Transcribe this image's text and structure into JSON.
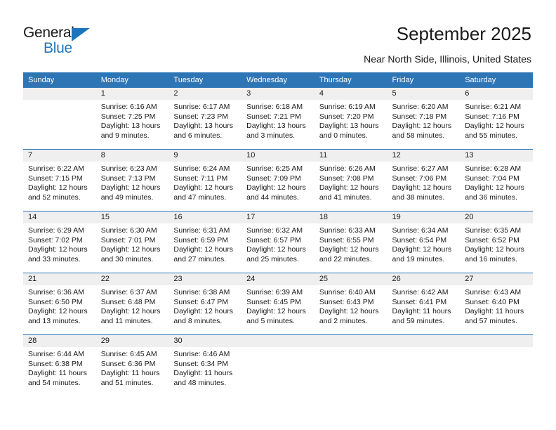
{
  "brand": {
    "name_top": "General",
    "name_bottom": "Blue",
    "accent_color": "#1c75bc"
  },
  "header": {
    "title": "September 2025",
    "subtitle": "Near North Side, Illinois, United States",
    "header_bg": "#2e75b6",
    "daynum_bg": "#efefef"
  },
  "weekdays": [
    "Sunday",
    "Monday",
    "Tuesday",
    "Wednesday",
    "Thursday",
    "Friday",
    "Saturday"
  ],
  "labels": {
    "sunrise": "Sunrise:",
    "sunset": "Sunset:",
    "daylight": "Daylight:"
  },
  "weeks": [
    [
      {
        "day": "",
        "empty": true
      },
      {
        "day": "1",
        "sunrise": "Sunrise: 6:16 AM",
        "sunset": "Sunset: 7:25 PM",
        "daylight1": "Daylight: 13 hours",
        "daylight2": "and 9 minutes."
      },
      {
        "day": "2",
        "sunrise": "Sunrise: 6:17 AM",
        "sunset": "Sunset: 7:23 PM",
        "daylight1": "Daylight: 13 hours",
        "daylight2": "and 6 minutes."
      },
      {
        "day": "3",
        "sunrise": "Sunrise: 6:18 AM",
        "sunset": "Sunset: 7:21 PM",
        "daylight1": "Daylight: 13 hours",
        "daylight2": "and 3 minutes."
      },
      {
        "day": "4",
        "sunrise": "Sunrise: 6:19 AM",
        "sunset": "Sunset: 7:20 PM",
        "daylight1": "Daylight: 13 hours",
        "daylight2": "and 0 minutes."
      },
      {
        "day": "5",
        "sunrise": "Sunrise: 6:20 AM",
        "sunset": "Sunset: 7:18 PM",
        "daylight1": "Daylight: 12 hours",
        "daylight2": "and 58 minutes."
      },
      {
        "day": "6",
        "sunrise": "Sunrise: 6:21 AM",
        "sunset": "Sunset: 7:16 PM",
        "daylight1": "Daylight: 12 hours",
        "daylight2": "and 55 minutes."
      }
    ],
    [
      {
        "day": "7",
        "sunrise": "Sunrise: 6:22 AM",
        "sunset": "Sunset: 7:15 PM",
        "daylight1": "Daylight: 12 hours",
        "daylight2": "and 52 minutes."
      },
      {
        "day": "8",
        "sunrise": "Sunrise: 6:23 AM",
        "sunset": "Sunset: 7:13 PM",
        "daylight1": "Daylight: 12 hours",
        "daylight2": "and 49 minutes."
      },
      {
        "day": "9",
        "sunrise": "Sunrise: 6:24 AM",
        "sunset": "Sunset: 7:11 PM",
        "daylight1": "Daylight: 12 hours",
        "daylight2": "and 47 minutes."
      },
      {
        "day": "10",
        "sunrise": "Sunrise: 6:25 AM",
        "sunset": "Sunset: 7:09 PM",
        "daylight1": "Daylight: 12 hours",
        "daylight2": "and 44 minutes."
      },
      {
        "day": "11",
        "sunrise": "Sunrise: 6:26 AM",
        "sunset": "Sunset: 7:08 PM",
        "daylight1": "Daylight: 12 hours",
        "daylight2": "and 41 minutes."
      },
      {
        "day": "12",
        "sunrise": "Sunrise: 6:27 AM",
        "sunset": "Sunset: 7:06 PM",
        "daylight1": "Daylight: 12 hours",
        "daylight2": "and 38 minutes."
      },
      {
        "day": "13",
        "sunrise": "Sunrise: 6:28 AM",
        "sunset": "Sunset: 7:04 PM",
        "daylight1": "Daylight: 12 hours",
        "daylight2": "and 36 minutes."
      }
    ],
    [
      {
        "day": "14",
        "sunrise": "Sunrise: 6:29 AM",
        "sunset": "Sunset: 7:02 PM",
        "daylight1": "Daylight: 12 hours",
        "daylight2": "and 33 minutes."
      },
      {
        "day": "15",
        "sunrise": "Sunrise: 6:30 AM",
        "sunset": "Sunset: 7:01 PM",
        "daylight1": "Daylight: 12 hours",
        "daylight2": "and 30 minutes."
      },
      {
        "day": "16",
        "sunrise": "Sunrise: 6:31 AM",
        "sunset": "Sunset: 6:59 PM",
        "daylight1": "Daylight: 12 hours",
        "daylight2": "and 27 minutes."
      },
      {
        "day": "17",
        "sunrise": "Sunrise: 6:32 AM",
        "sunset": "Sunset: 6:57 PM",
        "daylight1": "Daylight: 12 hours",
        "daylight2": "and 25 minutes."
      },
      {
        "day": "18",
        "sunrise": "Sunrise: 6:33 AM",
        "sunset": "Sunset: 6:55 PM",
        "daylight1": "Daylight: 12 hours",
        "daylight2": "and 22 minutes."
      },
      {
        "day": "19",
        "sunrise": "Sunrise: 6:34 AM",
        "sunset": "Sunset: 6:54 PM",
        "daylight1": "Daylight: 12 hours",
        "daylight2": "and 19 minutes."
      },
      {
        "day": "20",
        "sunrise": "Sunrise: 6:35 AM",
        "sunset": "Sunset: 6:52 PM",
        "daylight1": "Daylight: 12 hours",
        "daylight2": "and 16 minutes."
      }
    ],
    [
      {
        "day": "21",
        "sunrise": "Sunrise: 6:36 AM",
        "sunset": "Sunset: 6:50 PM",
        "daylight1": "Daylight: 12 hours",
        "daylight2": "and 13 minutes."
      },
      {
        "day": "22",
        "sunrise": "Sunrise: 6:37 AM",
        "sunset": "Sunset: 6:48 PM",
        "daylight1": "Daylight: 12 hours",
        "daylight2": "and 11 minutes."
      },
      {
        "day": "23",
        "sunrise": "Sunrise: 6:38 AM",
        "sunset": "Sunset: 6:47 PM",
        "daylight1": "Daylight: 12 hours",
        "daylight2": "and 8 minutes."
      },
      {
        "day": "24",
        "sunrise": "Sunrise: 6:39 AM",
        "sunset": "Sunset: 6:45 PM",
        "daylight1": "Daylight: 12 hours",
        "daylight2": "and 5 minutes."
      },
      {
        "day": "25",
        "sunrise": "Sunrise: 6:40 AM",
        "sunset": "Sunset: 6:43 PM",
        "daylight1": "Daylight: 12 hours",
        "daylight2": "and 2 minutes."
      },
      {
        "day": "26",
        "sunrise": "Sunrise: 6:42 AM",
        "sunset": "Sunset: 6:41 PM",
        "daylight1": "Daylight: 11 hours",
        "daylight2": "and 59 minutes."
      },
      {
        "day": "27",
        "sunrise": "Sunrise: 6:43 AM",
        "sunset": "Sunset: 6:40 PM",
        "daylight1": "Daylight: 11 hours",
        "daylight2": "and 57 minutes."
      }
    ],
    [
      {
        "day": "28",
        "sunrise": "Sunrise: 6:44 AM",
        "sunset": "Sunset: 6:38 PM",
        "daylight1": "Daylight: 11 hours",
        "daylight2": "and 54 minutes."
      },
      {
        "day": "29",
        "sunrise": "Sunrise: 6:45 AM",
        "sunset": "Sunset: 6:36 PM",
        "daylight1": "Daylight: 11 hours",
        "daylight2": "and 51 minutes."
      },
      {
        "day": "30",
        "sunrise": "Sunrise: 6:46 AM",
        "sunset": "Sunset: 6:34 PM",
        "daylight1": "Daylight: 11 hours",
        "daylight2": "and 48 minutes."
      },
      {
        "day": "",
        "empty": true
      },
      {
        "day": "",
        "empty": true
      },
      {
        "day": "",
        "empty": true
      },
      {
        "day": "",
        "empty": true
      }
    ]
  ]
}
